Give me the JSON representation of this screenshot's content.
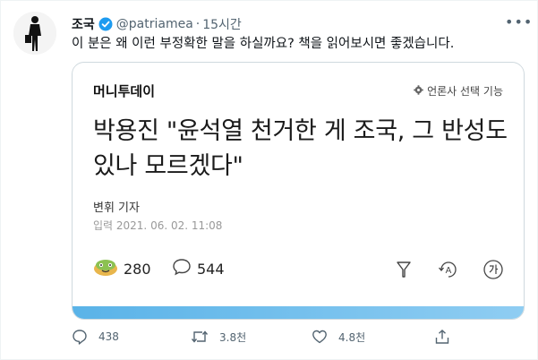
{
  "author": {
    "name": "조국",
    "handle": "@patriamea",
    "time": "15시간",
    "verified_color": "#1d9bf0"
  },
  "tweet": {
    "text": "이 분은 왜 이런 부정확한 말을 하실까요? 책을 읽어보시면 좋겠습니다."
  },
  "card": {
    "publisher": "머니투데이",
    "select_label": "언론사 선택 기능",
    "headline": "박용진 \"윤석열 천거한 게 조국, 그 반성도 있나 모르겠다\"",
    "reporter": "변휘 기자",
    "date": "입력 2021. 06. 02. 11:08",
    "reaction_count": "280",
    "comment_count": "544",
    "accent_color": "#5ab3e8"
  },
  "actions": {
    "replies": "438",
    "retweets": "3.8천",
    "likes": "4.8천"
  }
}
